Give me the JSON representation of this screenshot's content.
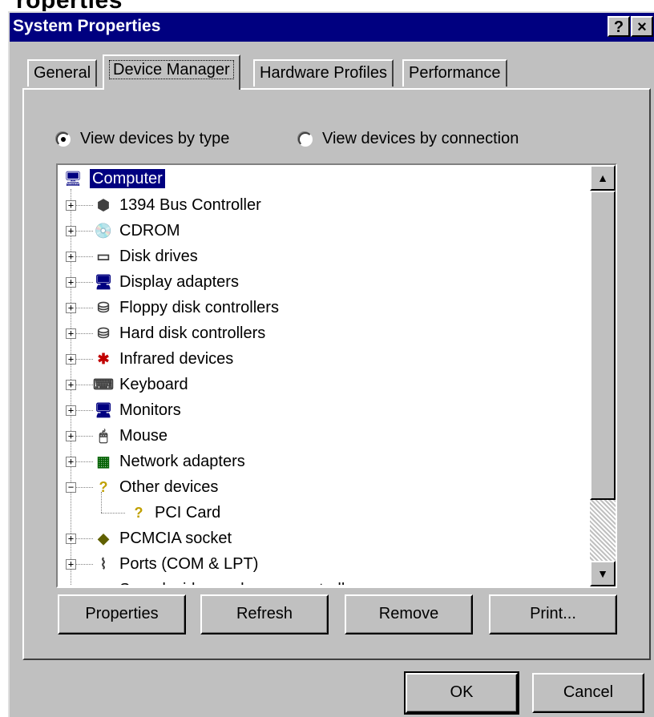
{
  "window": {
    "top_fragment": "roperties",
    "title": "System Properties",
    "help_button": "?",
    "close_button": "×"
  },
  "tabs": [
    {
      "label": "General",
      "active": false
    },
    {
      "label": "Device Manager",
      "active": true
    },
    {
      "label": "Hardware Profiles",
      "active": false
    },
    {
      "label": "Performance",
      "active": false
    }
  ],
  "view_options": {
    "by_type": "View devices by type",
    "by_connection": "View devices by connection",
    "selected": "by_type"
  },
  "tree": {
    "root": "Computer",
    "items": [
      {
        "label": "1394 Bus Controller",
        "icon": "bus-controller-icon",
        "glyph": "⬢",
        "expander": "+"
      },
      {
        "label": "CDROM",
        "icon": "cdrom-icon",
        "glyph": "💿",
        "expander": "+"
      },
      {
        "label": "Disk drives",
        "icon": "disk-drive-icon",
        "glyph": "▭",
        "expander": "+"
      },
      {
        "label": "Display adapters",
        "icon": "display-adapter-icon",
        "glyph": "🖥",
        "expander": "+"
      },
      {
        "label": "Floppy disk controllers",
        "icon": "floppy-controller-icon",
        "glyph": "⛁",
        "expander": "+"
      },
      {
        "label": "Hard disk controllers",
        "icon": "hard-disk-controller-icon",
        "glyph": "⛁",
        "expander": "+"
      },
      {
        "label": "Infrared devices",
        "icon": "infrared-icon",
        "glyph": "✱",
        "expander": "+"
      },
      {
        "label": "Keyboard",
        "icon": "keyboard-icon",
        "glyph": "⌨",
        "expander": "+"
      },
      {
        "label": "Monitors",
        "icon": "monitor-icon",
        "glyph": "🖥",
        "expander": "+"
      },
      {
        "label": "Mouse",
        "icon": "mouse-icon",
        "glyph": "🖱",
        "expander": "+"
      },
      {
        "label": "Network adapters",
        "icon": "network-adapter-icon",
        "glyph": "▦",
        "expander": "+"
      },
      {
        "label": "Other devices",
        "icon": "question-mark-icon",
        "glyph": "?",
        "expander": "−"
      },
      {
        "label": "PCI Card",
        "icon": "unknown-device-warning-icon",
        "glyph": "?",
        "child": true
      },
      {
        "label": "PCMCIA socket",
        "icon": "pcmcia-icon",
        "glyph": "◆",
        "expander": "+"
      },
      {
        "label": "Ports (COM & LPT)",
        "icon": "port-icon",
        "glyph": "⌇",
        "expander": "+"
      },
      {
        "label": "Sound, video and game controllers",
        "icon": "sound-controller-icon",
        "glyph": "♫",
        "expander": "+"
      }
    ]
  },
  "buttons": {
    "properties": "Properties",
    "refresh": "Refresh",
    "remove": "Remove",
    "print": "Print...",
    "ok": "OK",
    "cancel": "Cancel"
  },
  "colors": {
    "title_bar": "#000080",
    "face": "#c0c0c0",
    "selection": "#000080"
  }
}
